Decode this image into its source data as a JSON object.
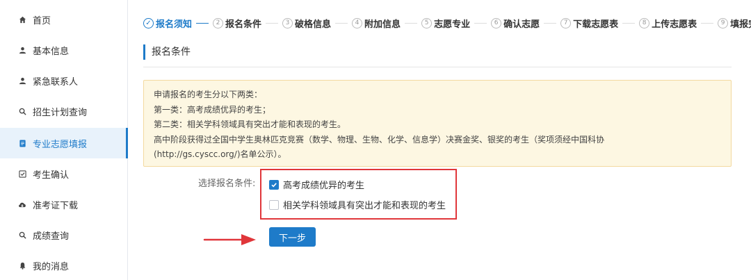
{
  "sidebar": {
    "items": [
      {
        "label": "首页",
        "icon": "home-icon",
        "active": false
      },
      {
        "label": "基本信息",
        "icon": "user-icon",
        "active": false
      },
      {
        "label": "紧急联系人",
        "icon": "user-icon",
        "active": false
      },
      {
        "label": "招生计划查询",
        "icon": "search-icon",
        "active": false
      },
      {
        "label": "专业志愿填报",
        "icon": "document-icon",
        "active": true
      },
      {
        "label": "考生确认",
        "icon": "checkbox-icon",
        "active": false
      },
      {
        "label": "准考证下载",
        "icon": "cloud-download-icon",
        "active": false
      },
      {
        "label": "成绩查询",
        "icon": "search-icon",
        "active": false
      },
      {
        "label": "我的消息",
        "icon": "bell-icon",
        "active": false
      }
    ]
  },
  "steps": [
    {
      "num": "✓",
      "label": "报名须知",
      "current": true
    },
    {
      "num": "2",
      "label": "报名条件",
      "current": false
    },
    {
      "num": "3",
      "label": "破格信息",
      "current": false
    },
    {
      "num": "4",
      "label": "附加信息",
      "current": false
    },
    {
      "num": "5",
      "label": "志愿专业",
      "current": false
    },
    {
      "num": "6",
      "label": "确认志愿",
      "current": false
    },
    {
      "num": "7",
      "label": "下载志愿表",
      "current": false
    },
    {
      "num": "8",
      "label": "上传志愿表",
      "current": false
    },
    {
      "num": "9",
      "label": "填报完成",
      "current": false
    }
  ],
  "section_title": "报名条件",
  "notice": {
    "lines": [
      "申请报名的考生分以下两类：",
      "第一类：高考成绩优异的考生；",
      "第二类：相关学科领域具有突出才能和表现的考生。",
      "高中阶段获得过全国中学生奥林匹克竞赛（数学、物理、生物、化学、信息学）决赛金奖、银奖的考生（奖项须经中国科协",
      "(http://gs.cyscc.org/)名单公示）。"
    ]
  },
  "form": {
    "label": "选择报名条件:",
    "options": [
      {
        "label": "高考成绩优异的考生",
        "checked": true
      },
      {
        "label": "相关学科领域具有突出才能和表现的考生",
        "checked": false
      }
    ]
  },
  "next_button": "下一步",
  "colors": {
    "accent": "#1e7bc9",
    "highlight_red": "#e0363a",
    "notice_bg": "#fdf7e2"
  }
}
